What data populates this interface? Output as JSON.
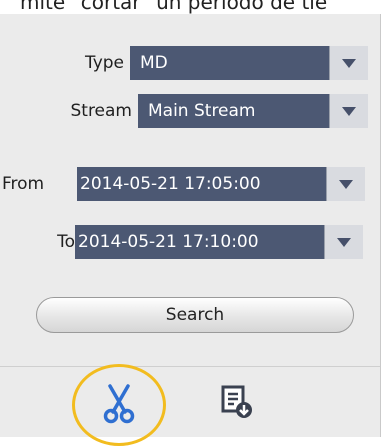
{
  "caption_fragment": "mite \"cortar\" un periodo de tie",
  "filter": {
    "type": {
      "label": "Type",
      "value": "MD"
    },
    "stream": {
      "label": "Stream",
      "value": "Main Stream"
    },
    "from": {
      "label": "From",
      "value": "2014-05-21 17:05:00"
    },
    "to": {
      "label": "To",
      "value": "2014-05-21 17:10:00"
    }
  },
  "search_label": "Search",
  "icons": {
    "clip": "scissors-icon",
    "download": "download-list-icon"
  },
  "colors": {
    "combo_bg": "#4c5873",
    "highlight": "#f2bc1f",
    "scissors": "#2f6fd1"
  }
}
